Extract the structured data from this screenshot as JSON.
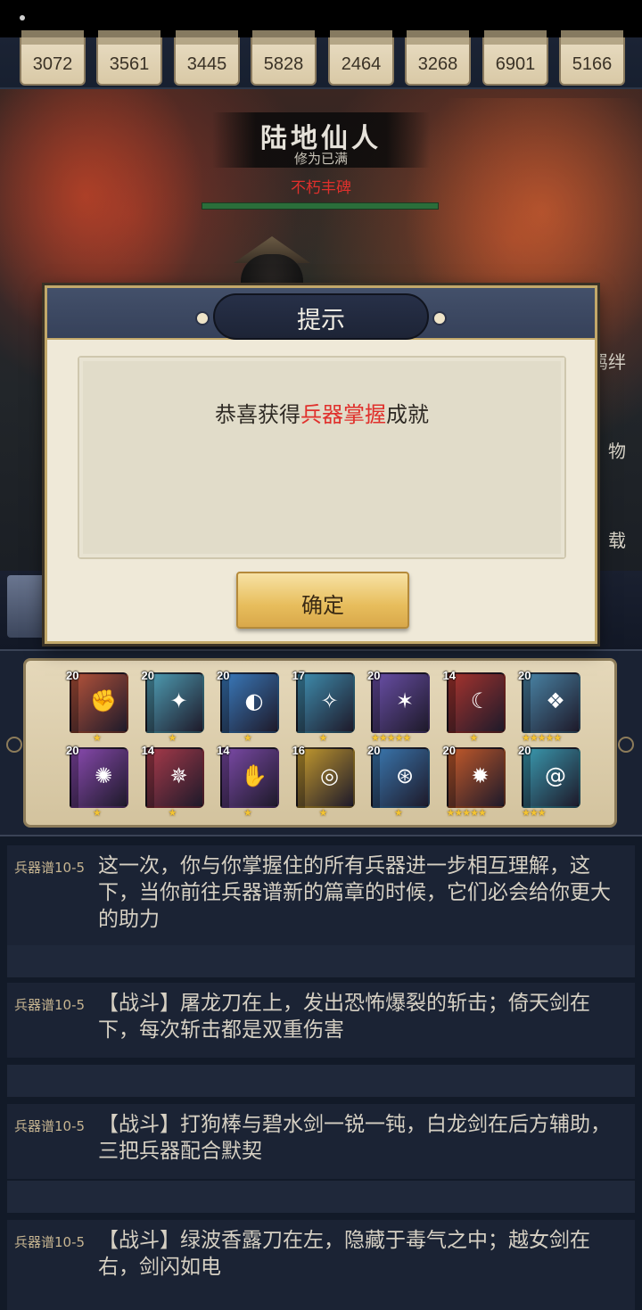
{
  "stats": [
    "3072",
    "3561",
    "3445",
    "5828",
    "2464",
    "3268",
    "6901",
    "5166"
  ],
  "realm": {
    "title": "陆地仙人",
    "subtitle": "修为已满",
    "red_text": "不朽丰碑"
  },
  "side_buttons": [
    "羁绊",
    "物",
    "载"
  ],
  "books": [
    {
      "level": "20",
      "stars": 1,
      "color": "#b5533a",
      "emblem": "✊",
      "icon": "fist-icon"
    },
    {
      "level": "20",
      "stars": 1,
      "color": "#4f9fb5",
      "emblem": "✦",
      "icon": "blade-icon"
    },
    {
      "level": "20",
      "stars": 1,
      "color": "#3a7bbd",
      "emblem": "◐",
      "icon": "swirl-icon"
    },
    {
      "level": "17",
      "stars": 1,
      "color": "#3f8fb0",
      "emblem": "✧",
      "icon": "ice-shard-icon"
    },
    {
      "level": "20",
      "stars": 5,
      "color": "#6a4fa8",
      "emblem": "✶",
      "icon": "star-burst-icon"
    },
    {
      "level": "14",
      "stars": 1,
      "color": "#a8342e",
      "emblem": "☾",
      "icon": "crescent-icon"
    },
    {
      "level": "20",
      "stars": 5,
      "color": "#4a86a8",
      "emblem": "❖",
      "icon": "shards-icon"
    },
    {
      "level": "20",
      "stars": 1,
      "color": "#8a4ab0",
      "emblem": "✺",
      "icon": "flower-icon"
    },
    {
      "level": "14",
      "stars": 1,
      "color": "#a83a4a",
      "emblem": "✵",
      "icon": "pinwheel-icon"
    },
    {
      "level": "14",
      "stars": 1,
      "color": "#7c4aa8",
      "emblem": "✋",
      "icon": "palm-icon"
    },
    {
      "level": "16",
      "stars": 1,
      "color": "#c49a2e",
      "emblem": "◎",
      "icon": "vortex-icon"
    },
    {
      "level": "20",
      "stars": 1,
      "color": "#3a78b0",
      "emblem": "⊛",
      "icon": "sword-circle-icon"
    },
    {
      "level": "20",
      "stars": 5,
      "color": "#c45a2a",
      "emblem": "✹",
      "icon": "beast-icon"
    },
    {
      "level": "20",
      "stars": 3,
      "color": "#3a9ab0",
      "emblem": "@",
      "icon": "wave-spiral-icon"
    }
  ],
  "logs": [
    {
      "tag": "兵器谱10-5",
      "text": "这一次，你与你掌握住的所有兵器进一步相互理解，这下，当你前往兵器谱新的篇章的时候，它们必会给你更大的助力"
    },
    {
      "tag": "兵器谱10-5",
      "text": "【战斗】屠龙刀在上，发出恐怖爆裂的斩击；倚天剑在下，每次斩击都是双重伤害"
    },
    {
      "tag": "兵器谱10-5",
      "text": "【战斗】打狗棒与碧水剑一锐一钝，白龙剑在后方辅助，三把兵器配合默契"
    },
    {
      "tag": "兵器谱10-5",
      "text": "【战斗】绿波香露刀在左，隐藏于毒气之中；越女剑在右，剑闪如电"
    }
  ],
  "dialog": {
    "title": "提示",
    "message_prefix": "恭喜获得",
    "message_highlight": "兵器掌握",
    "message_suffix": "成就",
    "ok_label": "确定"
  },
  "colors": {
    "highlight_red": "#e0302c",
    "button_gold": "#e7bd5c",
    "hp_green": "#2a6e3a"
  }
}
